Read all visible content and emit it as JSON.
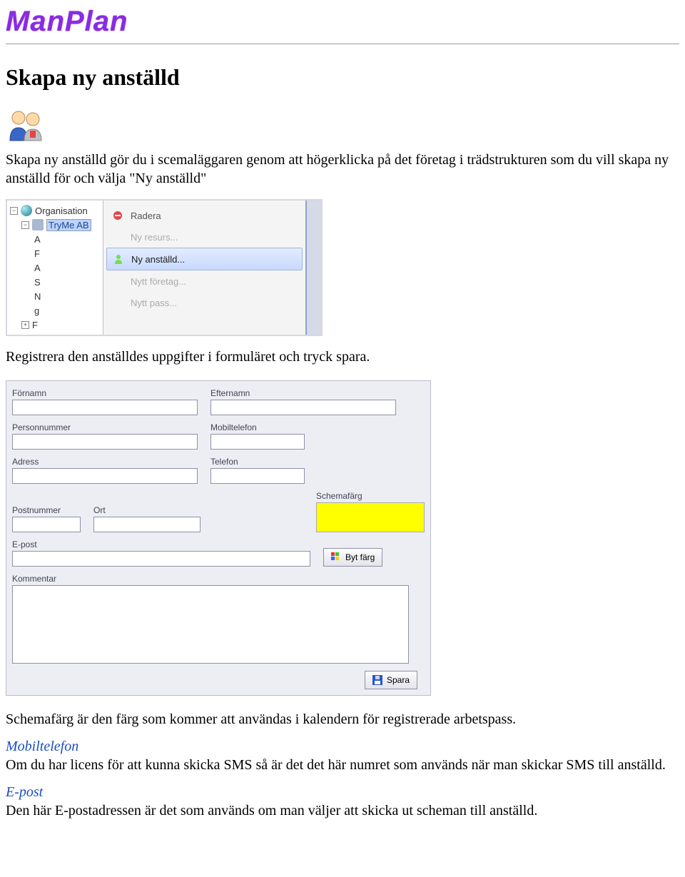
{
  "logo_text": "ManPlan",
  "title": "Skapa ny anställd",
  "intro": "Skapa ny anställd gör du i scemaläggaren genom att högerklicka på det företag i trädstrukturen som du vill skapa ny anställd för och välja \"Ny anställd\"",
  "tree": {
    "root": "Organisation",
    "company": "TryMe AB",
    "leaves": [
      "A",
      "F",
      "A",
      "S",
      "N",
      "g",
      "F"
    ]
  },
  "context_menu": {
    "radera": "Radera",
    "ny_resurs": "Ny resurs...",
    "ny_anstalld": "Ny anställd...",
    "nytt_foretag": "Nytt företag...",
    "nytt_pass": "Nytt pass..."
  },
  "para2": "Registrera den anställdes uppgifter i formuläret och tryck spara.",
  "form": {
    "fornamn": "Förnamn",
    "efternamn": "Efternamn",
    "personnummer": "Personnummer",
    "mobiltelefon": "Mobiltelefon",
    "adress": "Adress",
    "telefon": "Telefon",
    "postnummer": "Postnummer",
    "ort": "Ort",
    "schemafarg": "Schemafärg",
    "epost": "E-post",
    "byt_farg": "Byt färg",
    "kommentar": "Kommentar",
    "spara": "Spara"
  },
  "para3": "Schemafärg är den färg som kommer att användas i kalendern för registrerade arbetspass.",
  "mobil_heading": "Mobiltelefon",
  "mobil_text": "Om du har licens för att kunna skicka SMS så är det det här numret som används när man skickar SMS till anställd.",
  "epost_heading": "E-post",
  "epost_text": "Den här E-postadressen är det som används om man väljer att skicka ut scheman till anställd."
}
